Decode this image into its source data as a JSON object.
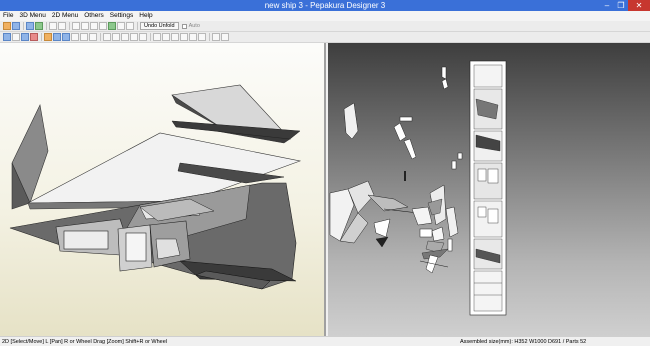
{
  "window": {
    "title": "new ship 3 - Pepakura Designer 3",
    "min_glyph": "–",
    "max_glyph": "❐",
    "close_glyph": "✕"
  },
  "menu": {
    "items": [
      "File",
      "3D Menu",
      "2D Menu",
      "Others",
      "Settings",
      "Help"
    ]
  },
  "toolbar": {
    "undo_unfold_label": "Undo Unfold",
    "auto_label": "Auto"
  },
  "status": {
    "left": "2D [Select/Move] L [Pan] R or Wheel Drag [Zoom] Shift+R or Wheel",
    "right": "Assembled size(mm): H352 W1000 D691 / Parts 52"
  },
  "colors": {
    "titlebar": "#3a70d8",
    "close_button": "#c7372f",
    "pane_3d_bg": "#f4f2e4",
    "pane_2d_bg": "#7c7c7c"
  }
}
